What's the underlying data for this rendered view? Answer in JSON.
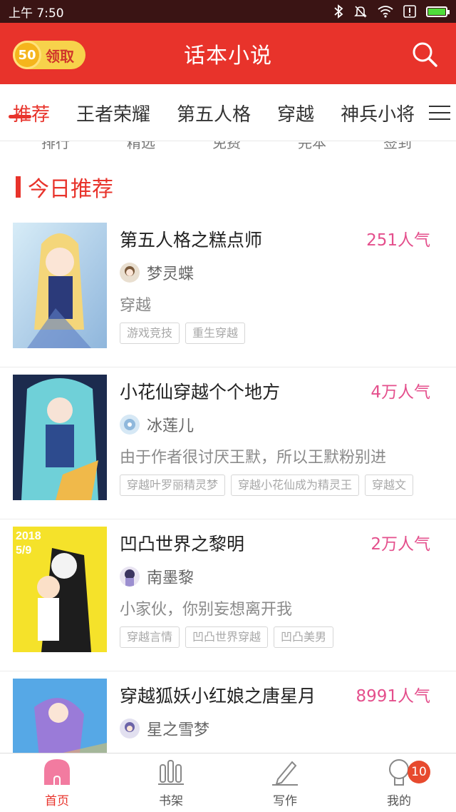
{
  "status_bar": {
    "time": "上午 7:50",
    "battery_level": 1.0
  },
  "header": {
    "coin_value": "50",
    "coin_label": "领取",
    "title": "话本小说"
  },
  "categories": [
    "推荐",
    "王者荣耀",
    "第五人格",
    "穿越",
    "神兵小将"
  ],
  "quick_entries": [
    "排行",
    "精选",
    "免费",
    "完本",
    "签到"
  ],
  "section": {
    "title": "今日推荐"
  },
  "books": [
    {
      "title": "第五人格之糕点师",
      "popularity": "251人气",
      "author": "梦灵蝶",
      "desc": "穿越",
      "tags": [
        "游戏竞技",
        "重生穿越"
      ]
    },
    {
      "title": "小花仙穿越个个地方",
      "popularity": "4万人气",
      "author": "冰莲儿",
      "desc": "由于作者很讨厌王默，所以王默粉别进",
      "tags": [
        "穿越叶罗丽精灵梦",
        "穿越小花仙成为精灵王",
        "穿越文"
      ]
    },
    {
      "title": "凹凸世界之黎明",
      "popularity": "2万人气",
      "author": "南墨黎",
      "desc": "小家伙，你别妄想离开我",
      "tags": [
        "穿越言情",
        "凹凸世界穿越",
        "凹凸美男"
      ]
    },
    {
      "title": "穿越狐妖小红娘之唐星月",
      "popularity": "8991人气",
      "author": "星之雪梦",
      "desc": "",
      "tags": []
    }
  ],
  "cover_texts": {
    "book3_line1": "2018",
    "book3_line2": "5/9"
  },
  "bottom_nav": [
    {
      "label": "首页"
    },
    {
      "label": "书架"
    },
    {
      "label": "写作"
    },
    {
      "label": "我的",
      "badge": "10"
    }
  ],
  "colors": {
    "brand": "#e8332b",
    "popularity": "#e44f8c",
    "status_bar": "#3a1414"
  }
}
